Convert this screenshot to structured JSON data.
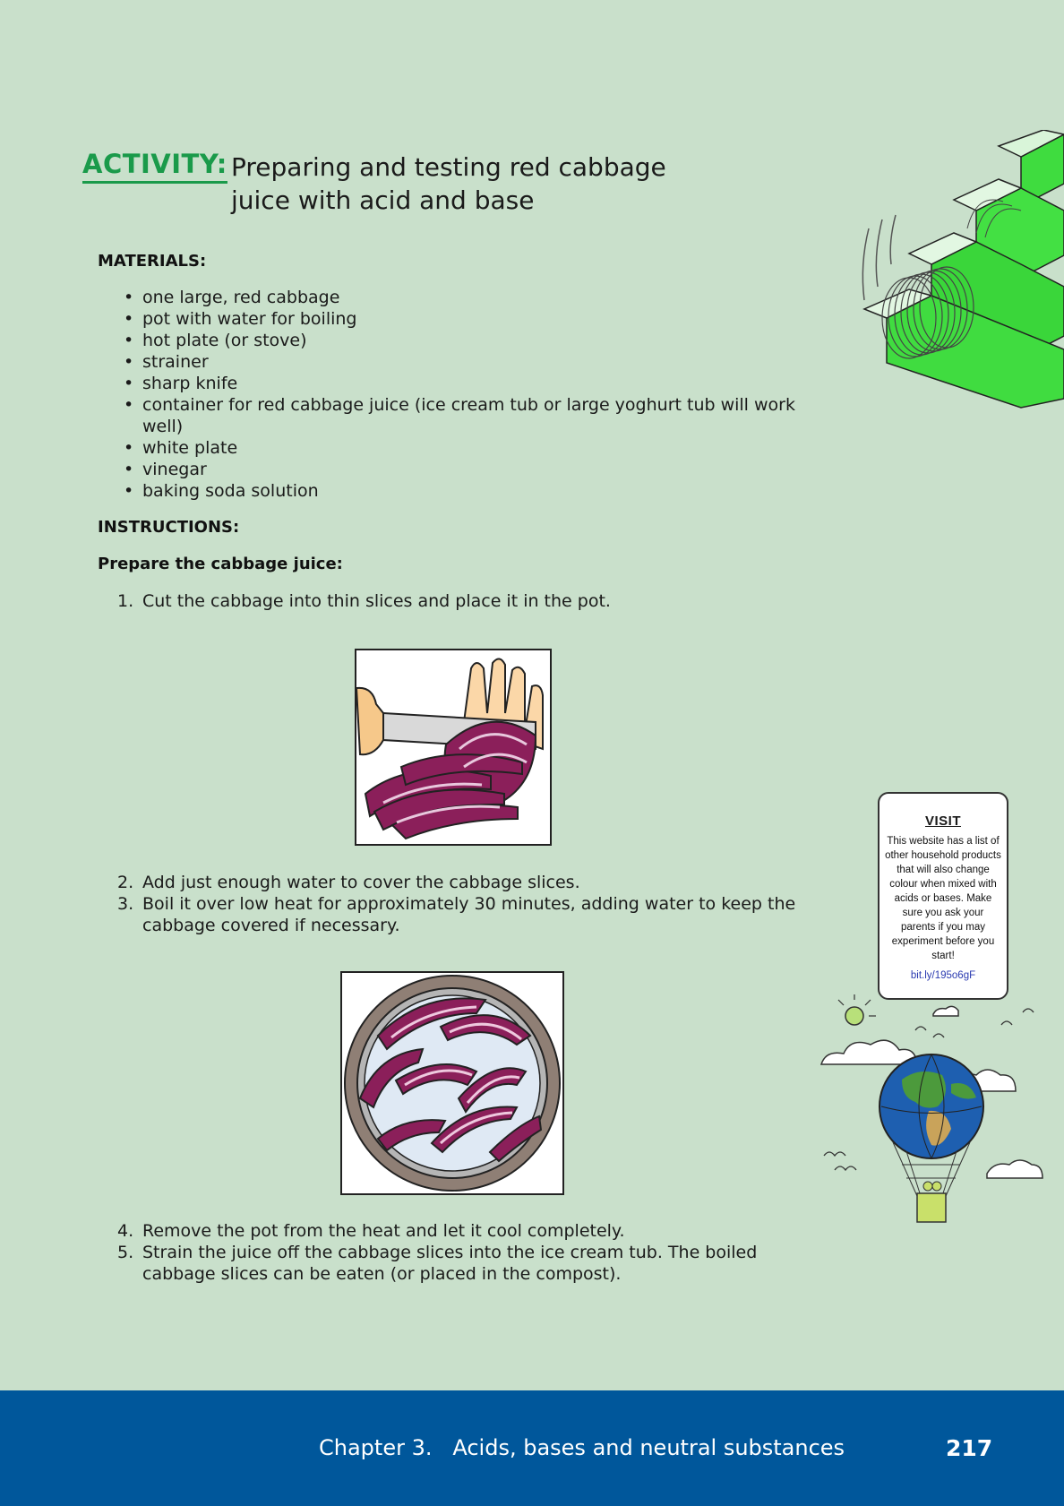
{
  "heading": {
    "label": "ACTIVITY:",
    "title_line1": "Preparing and testing red cabbage",
    "title_line2": "juice with acid and base"
  },
  "materials": {
    "heading": "MATERIALS:",
    "items": [
      "one large, red cabbage",
      "pot with water for boiling",
      "hot plate (or stove)",
      "strainer",
      "sharp knife",
      "container for red cabbage juice (ice cream tub or large yoghurt tub will work well)",
      "white plate",
      "vinegar",
      "baking soda solution"
    ]
  },
  "instructions": {
    "heading": "INSTRUCTIONS:",
    "subheading": "Prepare the cabbage juice:",
    "steps": [
      {
        "num": "1.",
        "text": "Cut the cabbage into thin slices and place it in the pot."
      },
      {
        "num": "2.",
        "text": "Add just enough water to cover the cabbage slices."
      },
      {
        "num": "3.",
        "text": "Boil it over low heat for approximately 30 minutes, adding water to keep the cabbage covered if necessary."
      },
      {
        "num": "4.",
        "text": "Remove the pot from the heat and let it cool completely."
      },
      {
        "num": "5.",
        "text": "Strain the juice off the cabbage slices into the ice cream tub. The boiled cabbage slices can be eaten (or placed in the compost)."
      }
    ]
  },
  "visit": {
    "title": "VISIT",
    "text": "This website has a list of other household products that will also change colour when mixed with acids or bases. Make sure you ask your parents if you may experiment before you start!",
    "link": "bit.ly/195o6gF"
  },
  "footer": {
    "chapter": "Chapter 3.   Acids, bases and neutral substances",
    "page_number": "217"
  },
  "colors": {
    "background": "#c9e0cb",
    "accent_green": "#1a9a4a",
    "footer_blue": "#00579b",
    "cabbage_purple": "#8b1f5a"
  },
  "icons": [
    "slinky-stairs-illustration",
    "cutting-cabbage-illustration",
    "boiling-pot-illustration",
    "globe-balloon-illustration"
  ]
}
